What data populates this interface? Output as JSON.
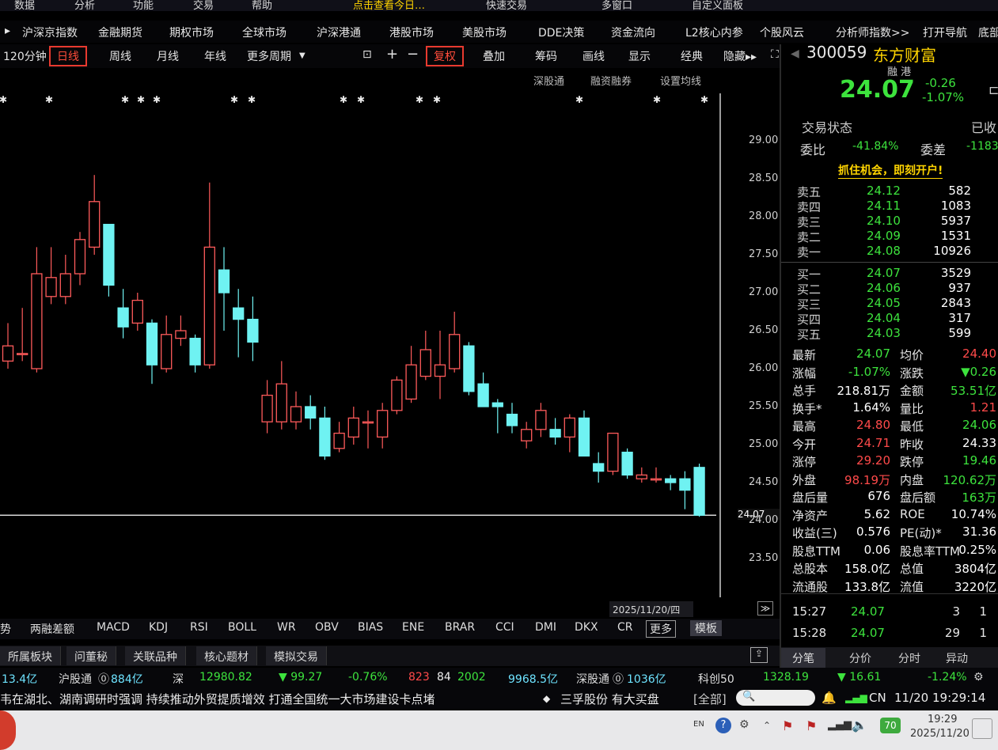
{
  "top_menu": [
    "数据",
    "分析",
    "功能",
    "交易",
    "帮助",
    "点击查看今日…",
    "快速交易",
    "多窗口",
    "自定义面板"
  ],
  "market_bar": [
    "沪深京指数",
    "金融期货",
    "期权市场",
    "全球市场",
    "沪深港通",
    "港股市场",
    "美股市场",
    "DDE决策",
    "资金流向",
    "L2核心内参",
    "个股风云",
    "分析师指数>>",
    "打开导航",
    "底部"
  ],
  "toolbar": {
    "period_120": "120分钟",
    "daily": "日线",
    "weekly": "周线",
    "monthly": "月线",
    "yearly": "年线",
    "more_periods": "更多周期",
    "lock": "⊡",
    "plus": "+",
    "minus": "−",
    "adjust": "复权",
    "overlay": "叠加",
    "chips": "筹码",
    "draw": "画线",
    "display": "显示",
    "classic": "经典",
    "hide": "隐藏▸▸",
    "fullscreen": "⛶"
  },
  "sub_tools": [
    "深股通",
    "融资融券",
    "设置均线"
  ],
  "price_axis": [
    "29.00",
    "28.50",
    "28.00",
    "27.50",
    "27.00",
    "26.50",
    "26.00",
    "25.50",
    "25.00",
    "24.50",
    "24.07",
    "24.00",
    "23.50"
  ],
  "chart_data": {
    "type": "candlestick",
    "ylim": [
      23.3,
      29.3
    ],
    "last_price_line": 24.07,
    "candles": [
      {
        "o": 26.1,
        "h": 26.6,
        "l": 26.0,
        "c": 26.3
      },
      {
        "o": 26.2,
        "h": 26.8,
        "l": 26.1,
        "c": 26.2
      },
      {
        "o": 26.0,
        "h": 27.6,
        "l": 25.95,
        "c": 27.25
      },
      {
        "o": 26.95,
        "h": 27.6,
        "l": 26.85,
        "c": 27.2
      },
      {
        "o": 26.95,
        "h": 27.5,
        "l": 26.85,
        "c": 27.25
      },
      {
        "o": 27.25,
        "h": 27.8,
        "l": 27.1,
        "c": 27.7
      },
      {
        "o": 27.6,
        "h": 28.55,
        "l": 27.5,
        "c": 28.2
      },
      {
        "o": 27.9,
        "h": 27.9,
        "l": 26.95,
        "c": 27.1
      },
      {
        "o": 26.8,
        "h": 27.05,
        "l": 26.4,
        "c": 26.55
      },
      {
        "o": 26.6,
        "h": 27.0,
        "l": 26.5,
        "c": 26.9
      },
      {
        "o": 26.6,
        "h": 26.65,
        "l": 25.8,
        "c": 26.05
      },
      {
        "o": 26.0,
        "h": 26.7,
        "l": 25.95,
        "c": 26.45
      },
      {
        "o": 26.4,
        "h": 26.7,
        "l": 26.3,
        "c": 26.5
      },
      {
        "o": 26.4,
        "h": 26.45,
        "l": 25.95,
        "c": 26.05
      },
      {
        "o": 26.05,
        "h": 28.45,
        "l": 26.0,
        "c": 27.6
      },
      {
        "o": 27.3,
        "h": 27.6,
        "l": 26.5,
        "c": 27.0
      },
      {
        "o": 26.8,
        "h": 27.05,
        "l": 26.15,
        "c": 26.65
      },
      {
        "o": 26.65,
        "h": 26.95,
        "l": 26.1,
        "c": 26.35
      },
      {
        "o": 25.3,
        "h": 25.85,
        "l": 25.15,
        "c": 25.65
      },
      {
        "o": 25.3,
        "h": 26.1,
        "l": 25.2,
        "c": 25.8
      },
      {
        "o": 25.3,
        "h": 25.7,
        "l": 25.2,
        "c": 25.5
      },
      {
        "o": 25.5,
        "h": 25.65,
        "l": 25.2,
        "c": 25.35
      },
      {
        "o": 25.35,
        "h": 25.5,
        "l": 24.8,
        "c": 24.85
      },
      {
        "o": 24.95,
        "h": 25.3,
        "l": 24.9,
        "c": 25.15
      },
      {
        "o": 25.1,
        "h": 25.5,
        "l": 25.0,
        "c": 25.35
      },
      {
        "o": 25.3,
        "h": 25.45,
        "l": 24.95,
        "c": 25.3
      },
      {
        "o": 25.1,
        "h": 25.55,
        "l": 24.95,
        "c": 25.45
      },
      {
        "o": 25.45,
        "h": 25.9,
        "l": 25.4,
        "c": 25.85
      },
      {
        "o": 25.6,
        "h": 26.3,
        "l": 25.55,
        "c": 26.05
      },
      {
        "o": 25.9,
        "h": 26.5,
        "l": 25.85,
        "c": 26.25
      },
      {
        "o": 25.9,
        "h": 26.5,
        "l": 25.6,
        "c": 26.05
      },
      {
        "o": 26.0,
        "h": 26.75,
        "l": 25.95,
        "c": 26.45
      },
      {
        "o": 26.3,
        "h": 26.35,
        "l": 25.65,
        "c": 25.7
      },
      {
        "o": 25.8,
        "h": 25.95,
        "l": 25.5,
        "c": 25.5
      },
      {
        "o": 25.55,
        "h": 25.6,
        "l": 25.15,
        "c": 25.5
      },
      {
        "o": 25.4,
        "h": 25.55,
        "l": 25.15,
        "c": 25.25
      },
      {
        "o": 25.05,
        "h": 25.3,
        "l": 24.95,
        "c": 25.2
      },
      {
        "o": 25.2,
        "h": 25.55,
        "l": 25.1,
        "c": 25.45
      },
      {
        "o": 25.2,
        "h": 25.35,
        "l": 25.0,
        "c": 25.1
      },
      {
        "o": 25.1,
        "h": 25.4,
        "l": 24.9,
        "c": 25.35
      },
      {
        "o": 25.35,
        "h": 25.45,
        "l": 24.85,
        "c": 24.85
      },
      {
        "o": 24.75,
        "h": 24.9,
        "l": 24.5,
        "c": 24.65
      },
      {
        "o": 24.65,
        "h": 25.15,
        "l": 24.6,
        "c": 25.15
      },
      {
        "o": 24.9,
        "h": 24.95,
        "l": 24.55,
        "c": 24.6
      },
      {
        "o": 24.55,
        "h": 24.7,
        "l": 24.5,
        "c": 24.6
      },
      {
        "o": 24.55,
        "h": 24.7,
        "l": 24.5,
        "c": 24.55
      },
      {
        "o": 24.55,
        "h": 24.6,
        "l": 24.4,
        "c": 24.5
      },
      {
        "o": 24.55,
        "h": 24.65,
        "l": 24.15,
        "c": 24.4
      },
      {
        "o": 24.7,
        "h": 24.75,
        "l": 24.05,
        "c": 24.07
      }
    ]
  },
  "date_label": "2025/11/20/四",
  "expand_btn": "≫",
  "indicators": [
    "势",
    "两融差额",
    "MACD",
    "KDJ",
    "RSI",
    "BOLL",
    "WR",
    "OBV",
    "BIAS",
    "ENE",
    "BRAR",
    "CCI",
    "DMI",
    "DKX",
    "CR",
    "更多",
    "模板"
  ],
  "bottom_tabs": [
    "所属板块",
    "问董秘",
    "关联品种",
    "核心题材",
    "模拟交易"
  ],
  "stock": {
    "code": "300059",
    "name": "东方财富",
    "tag": "融 港",
    "price": "24.07",
    "change": "-0.26",
    "change_pct": "-1.07%",
    "trade_status_label": "交易状态",
    "trade_status_value": "已收",
    "weibi_label": "委比",
    "weibi_value": "-41.84%",
    "weicha_label": "委差",
    "weicha_value": "-1183",
    "promo": "抓住机会，即刻开户!"
  },
  "order_book": {
    "asks": [
      {
        "label": "卖五",
        "price": "24.12",
        "vol": "582"
      },
      {
        "label": "卖四",
        "price": "24.11",
        "vol": "1083"
      },
      {
        "label": "卖三",
        "price": "24.10",
        "vol": "5937"
      },
      {
        "label": "卖二",
        "price": "24.09",
        "vol": "1531"
      },
      {
        "label": "卖一",
        "price": "24.08",
        "vol": "10926"
      }
    ],
    "bids": [
      {
        "label": "买一",
        "price": "24.07",
        "vol": "3529"
      },
      {
        "label": "买二",
        "price": "24.06",
        "vol": "937"
      },
      {
        "label": "买三",
        "price": "24.05",
        "vol": "2843"
      },
      {
        "label": "买四",
        "price": "24.04",
        "vol": "317"
      },
      {
        "label": "买五",
        "price": "24.03",
        "vol": "599"
      }
    ]
  },
  "stats": [
    {
      "l1": "最新",
      "v1": "24.07",
      "c1": "green",
      "l2": "均价",
      "v2": "24.40",
      "c2": "red"
    },
    {
      "l1": "涨幅",
      "v1": "-1.07%",
      "c1": "green",
      "l2": "涨跌",
      "v2": "▼0.26",
      "c2": "green"
    },
    {
      "l1": "总手",
      "v1": "218.81万",
      "c1": "white",
      "l2": "金额",
      "v2": "53.51亿",
      "c2": "green"
    },
    {
      "l1": "换手*",
      "v1": "1.64%",
      "c1": "white",
      "l2": "量比",
      "v2": "1.21",
      "c2": "red"
    },
    {
      "l1": "最高",
      "v1": "24.80",
      "c1": "red",
      "l2": "最低",
      "v2": "24.06",
      "c2": "green"
    },
    {
      "l1": "今开",
      "v1": "24.71",
      "c1": "red",
      "l2": "昨收",
      "v2": "24.33",
      "c2": "white"
    },
    {
      "l1": "涨停",
      "v1": "29.20",
      "c1": "red",
      "l2": "跌停",
      "v2": "19.46",
      "c2": "green"
    },
    {
      "l1": "外盘",
      "v1": "98.19万",
      "c1": "red",
      "l2": "内盘",
      "v2": "120.62万",
      "c2": "green"
    },
    {
      "l1": "盘后量",
      "v1": "676",
      "c1": "white",
      "l2": "盘后额",
      "v2": "163万",
      "c2": "green"
    },
    {
      "l1": "净资产",
      "v1": "5.62",
      "c1": "white",
      "l2": "ROE",
      "v2": "10.74%",
      "c2": "white"
    },
    {
      "l1": "收益(三)",
      "v1": "0.576",
      "c1": "white",
      "l2": "PE(动)*",
      "v2": "31.36",
      "c2": "white"
    },
    {
      "l1": "股息TTM",
      "v1": "0.06",
      "c1": "white",
      "l2": "股息率TTM",
      "v2": "0.25%",
      "c2": "white"
    },
    {
      "l1": "总股本",
      "v1": "158.0亿",
      "c1": "white",
      "l2": "总值",
      "v2": "3804亿",
      "c2": "white"
    },
    {
      "l1": "流通股",
      "v1": "133.8亿",
      "c1": "white",
      "l2": "流值",
      "v2": "3220亿",
      "c2": "white"
    }
  ],
  "ticks": [
    {
      "time": "15:27",
      "price": "24.07",
      "vol": "3",
      "n": "1"
    },
    {
      "time": "15:28",
      "price": "24.07",
      "vol": "29",
      "n": "1"
    }
  ],
  "right_tabs": [
    "分笔",
    "分价",
    "分时",
    "异动"
  ],
  "status_strip": {
    "part1": "13.4亿",
    "hgt_label": "沪股通",
    "hgt_value": "884亿",
    "sz_label": "深",
    "sz_index": "12980.82",
    "sz_change": "▼ 99.27",
    "sz_pct": "-0.76%",
    "up": "823",
    "flat": "84",
    "down": "2002",
    "amount": "9968.5亿",
    "sgt_label": "深股通",
    "sgt_value": "1036亿",
    "kc_label": "科创50",
    "kc_index": "1328.19",
    "kc_change": "▼ 16.61",
    "kc_pct": "-1.24%"
  },
  "news": {
    "headline": "韦在湖北、湖南调研时强调  持续推动外贸提质增效  打通全国统一大市场建设卡点堵",
    "dot": "◆",
    "alert": "三孚股份  有大买盘",
    "filter": "[全部]",
    "lang": "CN",
    "datetime": "11/20  19:29:14"
  },
  "taskbar": {
    "lang": "EN",
    "time": "19:29",
    "date": "2025/11/20",
    "badge": "70"
  }
}
